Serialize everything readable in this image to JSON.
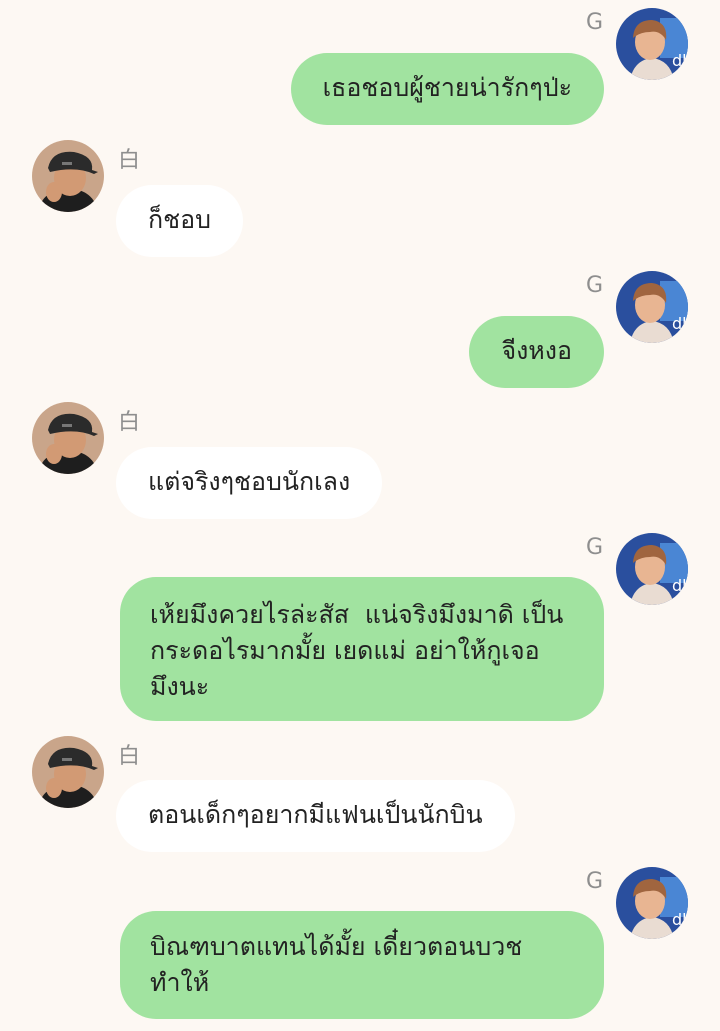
{
  "chat": {
    "messages": [
      {
        "sender": "G",
        "direction": "out",
        "text": "เธอชอบผู้ชายน่ารักๆป่ะ"
      },
      {
        "sender": "白",
        "direction": "in",
        "text": "ก็ชอบ"
      },
      {
        "sender": "G",
        "direction": "out",
        "text": "จีงหงอ"
      },
      {
        "sender": "白",
        "direction": "in",
        "text": "แต่จริงๆชอบนักเลง"
      },
      {
        "sender": "G",
        "direction": "out",
        "text": "เห้ยมึงควยไรล่ะสัส  แน่จริงมึงมาดิ เป็น\nกระดอไรมากมั้ย เยดแม่ อย่าให้กูเจอ\nมึงนะ"
      },
      {
        "sender": "白",
        "direction": "in",
        "text": "ตอนเด็กๆอยากมีแฟนเป็นนักบิน"
      },
      {
        "sender": "G",
        "direction": "out",
        "text": "บิณฑบาตแทนได้มั้ย เดี๋ยวตอนบวช\nทำให้"
      }
    ],
    "colors": {
      "background": "#fdf8f3",
      "outgoing_bubble": "#a1e3a0",
      "incoming_bubble": "#ffffff",
      "sender_name": "#8e8e8e"
    },
    "avatar_icons": {
      "G": "avatar-g-photo",
      "白": "avatar-bai-photo"
    }
  }
}
